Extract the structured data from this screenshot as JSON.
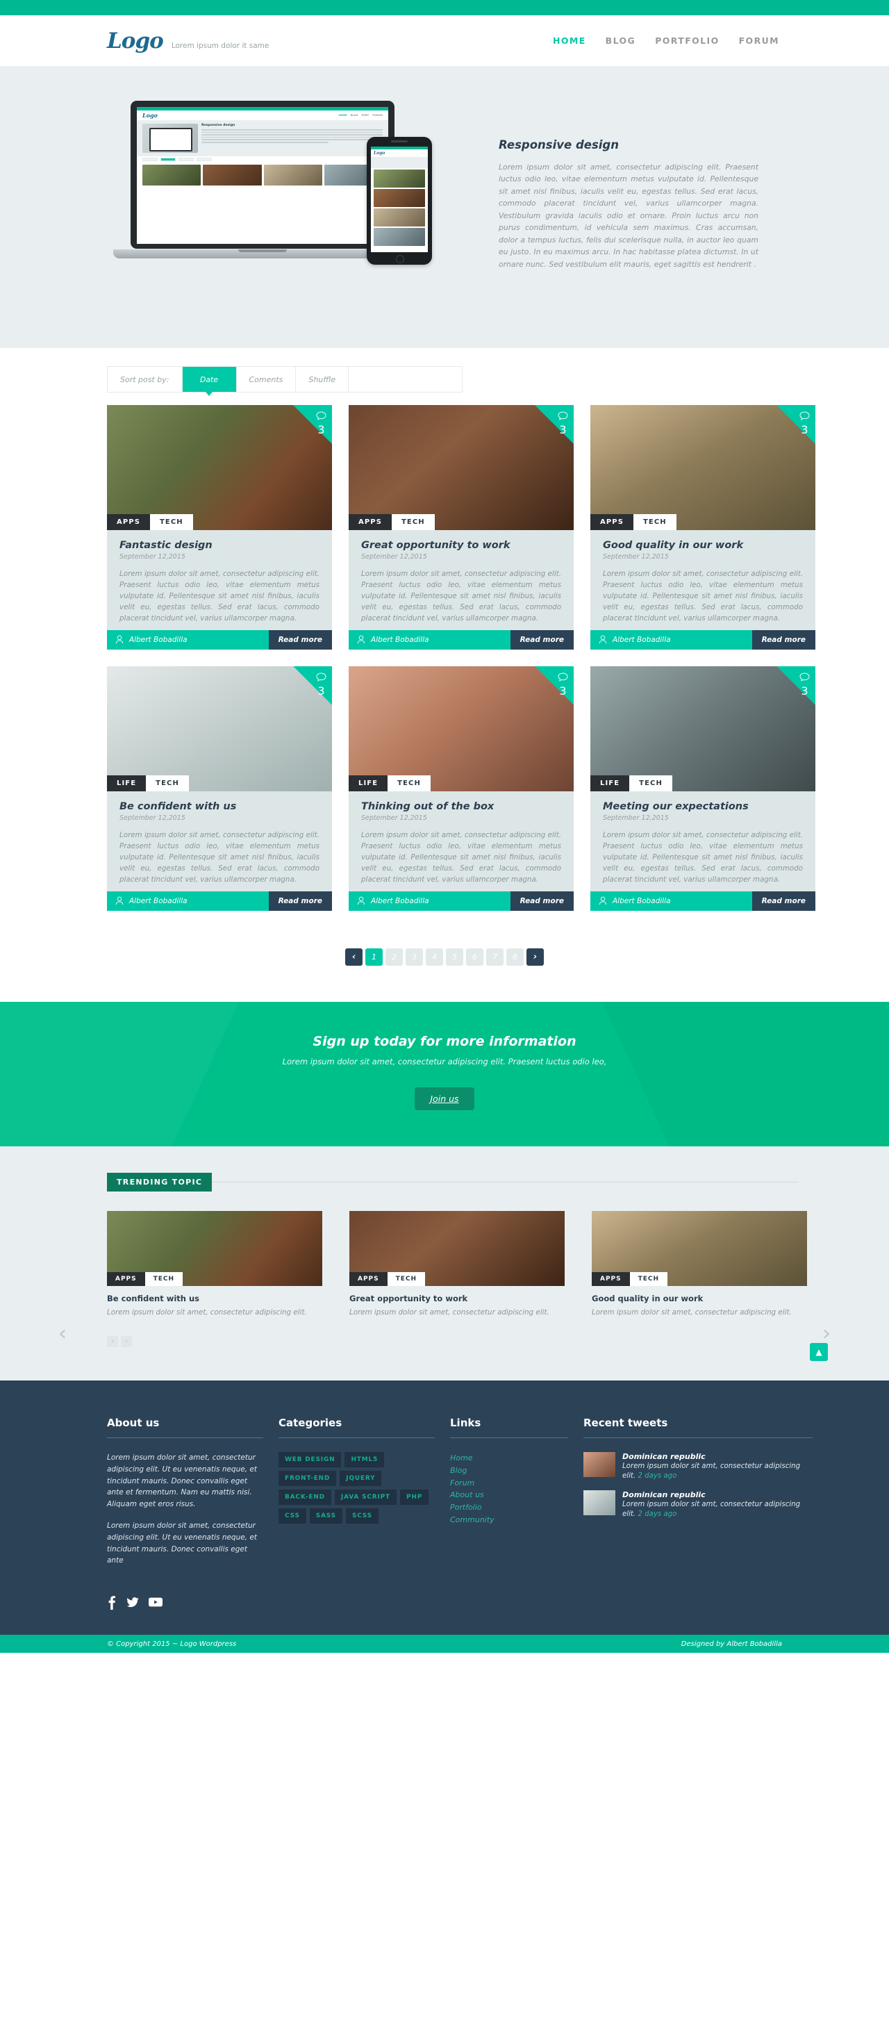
{
  "header": {
    "logo": "Logo",
    "tagline": "Lorem ipsum dolor it same",
    "nav": [
      {
        "label": "HOME",
        "active": true
      },
      {
        "label": "BLOG",
        "active": false
      },
      {
        "label": "PORTFOLIO",
        "active": false
      },
      {
        "label": "FORUM",
        "active": false
      }
    ]
  },
  "hero": {
    "title": "Responsive design",
    "body": "Lorem ipsum dolor sit amet, consectetur adipiscing elit. Praesent luctus odio leo, vitae elementum metus vulputate id. Pellentesque sit amet nisl finibus, iaculis velit eu, egestas tellus. Sed erat lacus, commodo placerat tincidunt vel, varius ullamcorper magna. Vestibulum gravida iaculis odio et ornare. Proin luctus arcu non purus condimentum, id vehicula sem maximus. Cras accumsan, dolor a tempus luctus, felis dui scelerisque nulla, in auctor leo quam eu justo. In eu maximus arcu. In hac habitasse platea dictumst. In ut ornare nunc. Sed vestibulum elit mauris, eget sagittis est hendrerit .",
    "mini": {
      "logo": "Logo",
      "nav": [
        "HOME",
        "BLOG",
        "PORT",
        "FORUM"
      ],
      "hero_title": "Responsive design"
    }
  },
  "sortbar": {
    "label": "Sort post by:",
    "options": [
      {
        "label": "Date",
        "active": true
      },
      {
        "label": "Coments",
        "active": false
      },
      {
        "label": "Shuffle",
        "active": false
      }
    ]
  },
  "posts": [
    {
      "title": "Fantastic design",
      "date": "September 12,2015",
      "excerpt": "Lorem ipsum dolor sit amet, consectetur adipiscing elit. Praesent luctus odio leo, vitae elementum metus vulputate id. Pellentesque sit amet nisl finibus, iaculis velit eu, egestas tellus. Sed erat lacus, commodo placerat tincidunt vel, varius ullamcorper magna.",
      "tags": [
        "APPS",
        "TECH"
      ],
      "comments": "3",
      "author": "Albert Bobadilla",
      "read_more": "Read more"
    },
    {
      "title": "Great opportunity to work",
      "date": "September 12,2015",
      "excerpt": "Lorem ipsum dolor sit amet, consectetur adipiscing elit. Praesent luctus odio leo, vitae elementum metus vulputate id. Pellentesque sit amet nisl finibus, iaculis velit eu, egestas tellus. Sed erat lacus, commodo placerat tincidunt vel, varius ullamcorper magna.",
      "tags": [
        "APPS",
        "TECH"
      ],
      "comments": "3",
      "author": "Albert Bobadilla",
      "read_more": "Read more"
    },
    {
      "title": "Good quality in our work",
      "date": "September 12,2015",
      "excerpt": "Lorem ipsum dolor sit amet, consectetur adipiscing elit. Praesent luctus odio leo, vitae elementum metus vulputate id. Pellentesque sit amet nisl finibus, iaculis velit eu, egestas tellus. Sed erat lacus, commodo placerat tincidunt vel, varius ullamcorper magna.",
      "tags": [
        "APPS",
        "TECH"
      ],
      "comments": "3",
      "author": "Albert Bobadilla",
      "read_more": "Read more"
    },
    {
      "title": "Be confident with us",
      "date": "September 12,2015",
      "excerpt": "Lorem ipsum dolor sit amet, consectetur adipiscing elit. Praesent luctus odio leo, vitae elementum metus vulputate id. Pellentesque sit amet nisl finibus, iaculis velit eu, egestas tellus. Sed erat lacus, commodo placerat tincidunt vel, varius ullamcorper magna.",
      "tags": [
        "LIFE",
        "TECH"
      ],
      "comments": "3",
      "author": "Albert Bobadilla",
      "read_more": "Read more"
    },
    {
      "title": "Thinking out of the box",
      "date": "September 12,2015",
      "excerpt": "Lorem ipsum dolor sit amet, consectetur adipiscing elit. Praesent luctus odio leo, vitae elementum metus vulputate id. Pellentesque sit amet nisl finibus, iaculis velit eu, egestas tellus. Sed erat lacus, commodo placerat tincidunt vel, varius ullamcorper magna.",
      "tags": [
        "LIFE",
        "TECH"
      ],
      "comments": "3",
      "author": "Albert Bobadilla",
      "read_more": "Read more"
    },
    {
      "title": "Meeting our expectations",
      "date": "September 12,2015",
      "excerpt": "Lorem ipsum dolor sit amet, consectetur adipiscing elit. Praesent luctus odio leo, vitae elementum metus vulputate id. Pellentesque sit amet nisl finibus, iaculis velit eu, egestas tellus. Sed erat lacus, commodo placerat tincidunt vel, varius ullamcorper magna.",
      "tags": [
        "LIFE",
        "TECH"
      ],
      "comments": "3",
      "author": "Albert Bobadilla",
      "read_more": "Read more"
    }
  ],
  "pagination": {
    "prev": "‹",
    "next": "›",
    "pages": [
      "1",
      "2",
      "3",
      "4",
      "5",
      "6",
      "7",
      "8"
    ],
    "current": "1"
  },
  "signup": {
    "title": "Sign up today for more information",
    "subtitle": "Lorem ipsum dolor sit amet, consectetur adipiscing elit. Praesent luctus odio leo,",
    "button": "Join us"
  },
  "trending": {
    "badge": "TRENDING TOPIC",
    "items": [
      {
        "title": "Be confident with us",
        "desc": "Lorem ipsum dolor sit amet, consectetur adipiscing elit.",
        "tags": [
          "APPS",
          "TECH"
        ]
      },
      {
        "title": "Great opportunity to work",
        "desc": "Lorem ipsum dolor sit amet, consectetur adipiscing elit.",
        "tags": [
          "APPS",
          "TECH"
        ]
      },
      {
        "title": "Good quality in our work",
        "desc": "Lorem ipsum dolor sit amet, consectetur adipiscing elit.",
        "tags": [
          "APPS",
          "TECH"
        ]
      }
    ],
    "prev_arrow": "‹",
    "next_arrow": "›",
    "dot_prev": "‹",
    "dot_next": "›",
    "to_top": "▲"
  },
  "footer": {
    "about": {
      "title": "About us",
      "p1": "Lorem ipsum dolor sit amet, consectetur adipiscing elit. Ut eu venenatis neque, et tincidunt mauris. Donec convallis eget ante et fermentum. Nam eu mattis nisi. Aliquam eget eros risus.",
      "p2": "Lorem ipsum dolor sit amet, consectetur adipiscing elit. Ut eu venenatis neque, et tincidunt mauris. Donec convallis eget ante"
    },
    "categories": {
      "title": "Categories",
      "tags": [
        "WEB DESIGN",
        "HTML5",
        "FRONT-END",
        "JQUERY",
        "BACK-END",
        "JAVA SCRIPT",
        "PHP",
        "CSS",
        "SASS",
        "SCSS"
      ]
    },
    "links": {
      "title": "Links",
      "items": [
        "Home",
        "Blog",
        "Forum",
        "About us",
        "Portfolio",
        "Community"
      ]
    },
    "tweets": {
      "title": "Recent tweets",
      "items": [
        {
          "name": "Dominican republic",
          "text": "Lorem ipsum dolor sit  amt, consectetur adipiscing elit.",
          "time": "2 days ago"
        },
        {
          "name": "Dominican republic",
          "text": "Lorem ipsum dolor sit  amt, consectetur adipiscing elit.",
          "time": "2 days ago"
        }
      ]
    },
    "social": [
      "facebook-icon",
      "twitter-icon",
      "youtube-icon"
    ]
  },
  "copyright": {
    "left": "© Copyright 2015 ~ Logo Wordpress",
    "right": "Designed by Albert Bobadilla"
  },
  "colors": {
    "teal": "#00c9a7",
    "teal_bar": "#00b894",
    "navy": "#2c4257",
    "light": "#e9eff0"
  }
}
